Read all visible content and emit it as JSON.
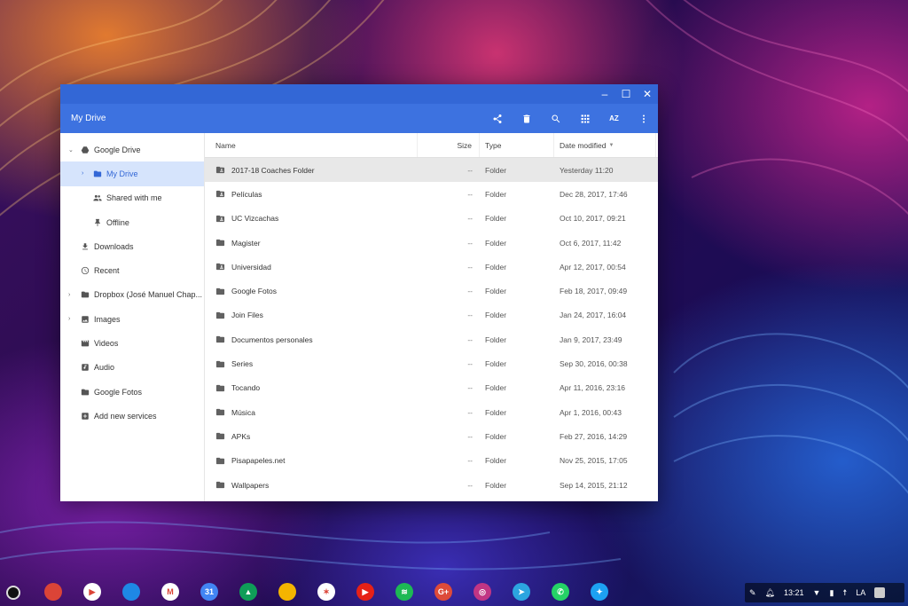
{
  "window": {
    "title": "My Drive"
  },
  "window_controls": {
    "minimize": "–",
    "maximize": "☐",
    "close": "✕"
  },
  "toolbar": {
    "sort_label": "AZ"
  },
  "sidebar": {
    "items": [
      {
        "label": "Google Drive",
        "icon": "google-drive-icon",
        "expander": "⌄"
      },
      {
        "label": "My Drive",
        "icon": "my-drive-icon",
        "expander": "›"
      },
      {
        "label": "Shared with me",
        "icon": "people-icon"
      },
      {
        "label": "Offline",
        "icon": "pin-icon"
      },
      {
        "label": "Downloads",
        "icon": "download-icon"
      },
      {
        "label": "Recent",
        "icon": "clock-icon"
      },
      {
        "label": "Dropbox (José Manuel Chap...",
        "icon": "folder-icon",
        "expander": "›"
      },
      {
        "label": "Images",
        "icon": "image-icon",
        "expander": "›"
      },
      {
        "label": "Videos",
        "icon": "video-icon"
      },
      {
        "label": "Audio",
        "icon": "audio-icon"
      },
      {
        "label": "Google Fotos",
        "icon": "photos-folder-icon"
      },
      {
        "label": "Add new services",
        "icon": "add-icon"
      }
    ]
  },
  "table": {
    "headers": {
      "name": "Name",
      "size": "Size",
      "type": "Type",
      "date": "Date modified"
    },
    "rows": [
      {
        "name": "2017-18 Coaches Folder",
        "size": "--",
        "type": "Folder",
        "date": "Yesterday 11:20",
        "shared": true
      },
      {
        "name": "Películas",
        "size": "--",
        "type": "Folder",
        "date": "Dec 28, 2017, 17:46",
        "shared": true
      },
      {
        "name": "UC Vizcachas",
        "size": "--",
        "type": "Folder",
        "date": "Oct 10, 2017, 09:21",
        "shared": true
      },
      {
        "name": "Magister",
        "size": "--",
        "type": "Folder",
        "date": "Oct 6, 2017, 11:42",
        "shared": false
      },
      {
        "name": "Universidad",
        "size": "--",
        "type": "Folder",
        "date": "Apr 12, 2017, 00:54",
        "shared": true
      },
      {
        "name": "Google Fotos",
        "size": "--",
        "type": "Folder",
        "date": "Feb 18, 2017, 09:49",
        "shared": false
      },
      {
        "name": "Join Files",
        "size": "--",
        "type": "Folder",
        "date": "Jan 24, 2017, 16:04",
        "shared": false
      },
      {
        "name": "Documentos personales",
        "size": "--",
        "type": "Folder",
        "date": "Jan 9, 2017, 23:49",
        "shared": false
      },
      {
        "name": "Series",
        "size": "--",
        "type": "Folder",
        "date": "Sep 30, 2016, 00:38",
        "shared": false
      },
      {
        "name": "Tocando",
        "size": "--",
        "type": "Folder",
        "date": "Apr 11, 2016, 23:16",
        "shared": false
      },
      {
        "name": "Música",
        "size": "--",
        "type": "Folder",
        "date": "Apr 1, 2016, 00:43",
        "shared": false
      },
      {
        "name": "APKs",
        "size": "--",
        "type": "Folder",
        "date": "Feb 27, 2016, 14:29",
        "shared": false
      },
      {
        "name": "Pisapapeles.net",
        "size": "--",
        "type": "Folder",
        "date": "Nov 25, 2015, 17:05",
        "shared": false
      },
      {
        "name": "Wallpapers",
        "size": "--",
        "type": "Folder",
        "date": "Sep 14, 2015, 21:12",
        "shared": false
      }
    ]
  },
  "shelf": {
    "apps": [
      {
        "name": "chrome-icon",
        "color": "#db4437",
        "glyph": ""
      },
      {
        "name": "play-store-icon",
        "color": "#ffffff",
        "glyph": "▶"
      },
      {
        "name": "files-icon",
        "color": "#1e88e5",
        "glyph": ""
      },
      {
        "name": "gmail-icon",
        "color": "#ffffff",
        "glyph": "M"
      },
      {
        "name": "calendar-icon",
        "color": "#4285f4",
        "glyph": "31"
      },
      {
        "name": "drive-icon",
        "color": "#0f9d58",
        "glyph": "▲"
      },
      {
        "name": "keep-icon",
        "color": "#f4b400",
        "glyph": ""
      },
      {
        "name": "photos-icon",
        "color": "#ffffff",
        "glyph": "✶"
      },
      {
        "name": "youtube-icon",
        "color": "#e62117",
        "glyph": "▶"
      },
      {
        "name": "spotify-icon",
        "color": "#1db954",
        "glyph": "≋"
      },
      {
        "name": "google-plus-icon",
        "color": "#dd4b39",
        "glyph": "G+"
      },
      {
        "name": "instagram-icon",
        "color": "#c13584",
        "glyph": "◎"
      },
      {
        "name": "telegram-icon",
        "color": "#2ca5e0",
        "glyph": "➤"
      },
      {
        "name": "whatsapp-icon",
        "color": "#25d366",
        "glyph": "✆"
      },
      {
        "name": "twitter-icon",
        "color": "#1da1f2",
        "glyph": "✦"
      }
    ],
    "tray": {
      "time": "13:21",
      "locale": "LA"
    }
  }
}
